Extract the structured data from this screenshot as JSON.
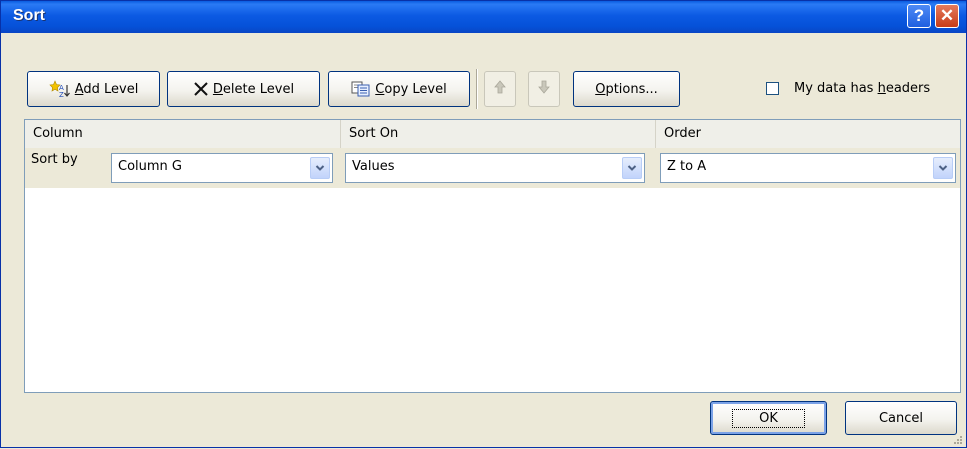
{
  "window": {
    "title": "Sort",
    "help_label": "?",
    "close_label": "✕"
  },
  "toolbar": {
    "add_level": {
      "access_key": "A",
      "rest": "dd Level"
    },
    "delete_level": {
      "access_key": "D",
      "rest": "elete Level"
    },
    "copy_level": {
      "access_key": "C",
      "rest": "opy Level"
    },
    "options": {
      "access_key": "O",
      "rest": "ptions..."
    },
    "headers_checkbox": {
      "prefix": "My data has ",
      "access_key": "h",
      "rest": "eaders",
      "checked": false
    }
  },
  "grid": {
    "headers": {
      "column": "Column",
      "sort_on": "Sort On",
      "order": "Order"
    },
    "rows": [
      {
        "label": "Sort by",
        "column": "Column G",
        "sort_on": "Values",
        "order": "Z to A"
      }
    ]
  },
  "footer": {
    "ok_label": "OK",
    "cancel_label": "Cancel"
  },
  "colors": {
    "title_bar": "#0a5ce0",
    "dialog_bg": "#ece9d8",
    "button_border": "#00337f"
  }
}
